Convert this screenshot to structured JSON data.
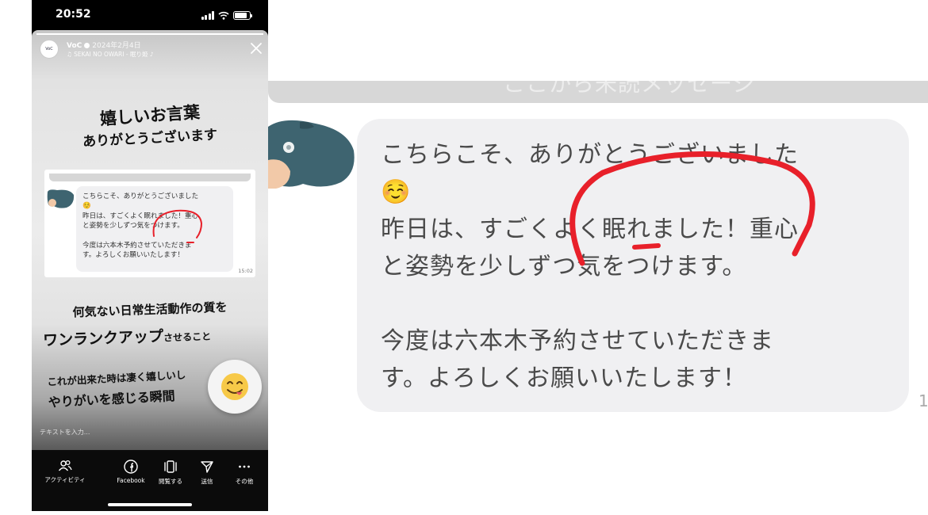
{
  "status_bar": {
    "time": "20:52"
  },
  "story": {
    "account_name": "VoC",
    "date": "2024年2月4日",
    "music": "♫ SEKAI NO OWARI - 眠り姫 ♪",
    "avatar_text": "VoC",
    "progress": 1.0,
    "headline_1": "嬉しいお言葉",
    "headline_2": "ありがとうございます",
    "middle_1": "何気ない日常生活動作の質を",
    "middle_2_big": "ワンランクアップ",
    "middle_2_small": "させること",
    "lower_1": "これが出来た時は凄く嬉しいし",
    "lower_2": "やりがいを感じる瞬間",
    "reply_placeholder": "テキストを入力..."
  },
  "chat": {
    "lines": [
      "こちらこそ、ありがとうございました",
      "☺️",
      "昨日は、すごくよく眠れました！重心",
      "と姿勢を少しずつ気をつけます。",
      "",
      "今度は六本木予約させていただきま",
      "す。よろしくお願いいたします！"
    ],
    "time": "15:02",
    "zoom_time_partial": "1",
    "zoom_banner": "ここから未読メッセージ"
  },
  "actions": [
    {
      "label": "アクティビティ",
      "icon": "people-icon"
    },
    {
      "label": "Facebook",
      "icon": "facebook-icon"
    },
    {
      "label": "閲覧する",
      "icon": "browse-icon"
    },
    {
      "label": "送信",
      "icon": "send-icon"
    },
    {
      "label": "その他",
      "icon": "more-icon"
    }
  ],
  "colors": {
    "highlight_red": "#e8202a",
    "bubble_bg": "#f0f0f2",
    "emoji_face": "#f7c948"
  }
}
